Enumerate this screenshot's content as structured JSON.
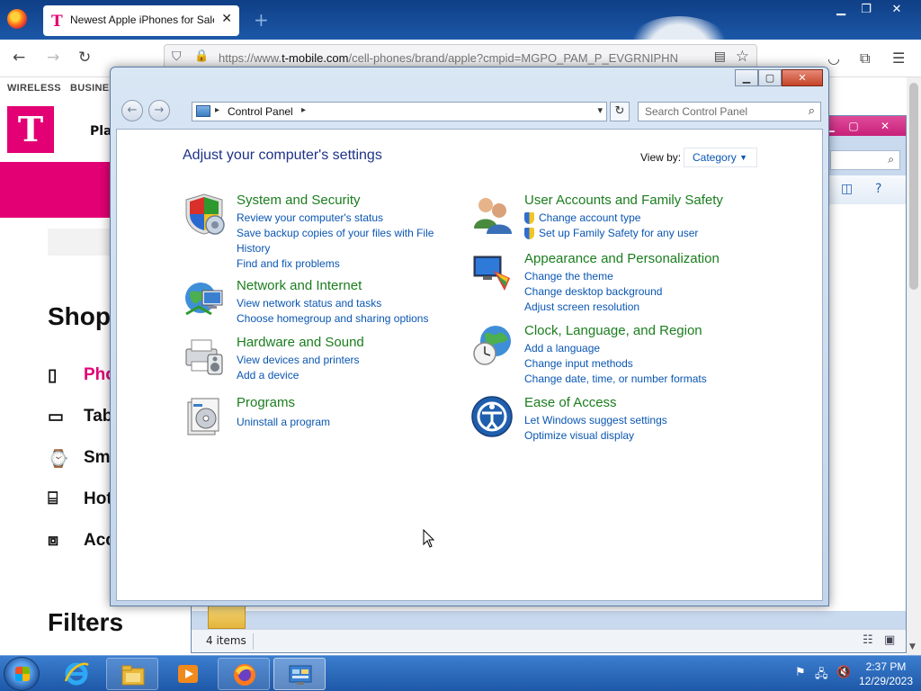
{
  "browser": {
    "tab_title": "Newest Apple iPhones for Sale",
    "tab_favicon": "T",
    "url_host_prefix": "https://www.",
    "url_host": "t-mobile.com",
    "url_path": "/cell-phones/brand/apple?cmpid=MGPO_PAM_P_EVGRNIPHN",
    "win_controls": [
      "minimize-icon",
      "maximize-icon",
      "close-icon"
    ]
  },
  "tmobile": {
    "topnav": [
      "WIRELESS",
      "BUSINE"
    ],
    "logo": "T",
    "plans_label": "Pla",
    "shop_heading": "Shop",
    "categories": [
      {
        "label": "Pho",
        "icon": "phone-icon"
      },
      {
        "label": "Tab",
        "icon": "tablet-icon"
      },
      {
        "label": "Sma",
        "icon": "watch-icon"
      },
      {
        "label": "Hot",
        "icon": "hotspot-icon"
      },
      {
        "label": "Acc",
        "icon": "accessory-icon"
      }
    ],
    "filters_heading": "Filters",
    "brand_color": "#e20074"
  },
  "explorer2": {
    "status_items": "4 items"
  },
  "control_panel": {
    "breadcrumb": "Control Panel",
    "search_placeholder": "Search Control Panel",
    "heading": "Adjust your computer's settings",
    "view_by_label": "View by:",
    "view_by_value": "Category",
    "categories": [
      {
        "title": "System and Security",
        "icon": "shield-icon",
        "links": [
          "Review your computer's status",
          "Save backup copies of your files with File History",
          "Find and fix problems"
        ]
      },
      {
        "title": "Network and Internet",
        "icon": "globe-network-icon",
        "links": [
          "View network status and tasks",
          "Choose homegroup and sharing options"
        ]
      },
      {
        "title": "Hardware and Sound",
        "icon": "printer-icon",
        "links": [
          "View devices and printers",
          "Add a device"
        ]
      },
      {
        "title": "Programs",
        "icon": "programs-icon",
        "links": [
          "Uninstall a program"
        ]
      },
      {
        "title": "User Accounts and Family Safety",
        "icon": "users-icon",
        "links": [
          "Change account type",
          "Set up Family Safety for any user"
        ]
      },
      {
        "title": "Appearance and Personalization",
        "icon": "appearance-icon",
        "links": [
          "Change the theme",
          "Change desktop background",
          "Adjust screen resolution"
        ]
      },
      {
        "title": "Clock, Language, and Region",
        "icon": "clock-globe-icon",
        "links": [
          "Add a language",
          "Change input methods",
          "Change date, time, or number formats"
        ]
      },
      {
        "title": "Ease of Access",
        "icon": "ease-of-access-icon",
        "links": [
          "Let Windows suggest settings",
          "Optimize visual display"
        ]
      }
    ]
  },
  "taskbar": {
    "apps": [
      "internet-explorer-icon",
      "file-explorer-icon",
      "media-player-icon",
      "firefox-icon",
      "control-panel-icon"
    ],
    "time": "2:37 PM",
    "date": "12/29/2023"
  }
}
